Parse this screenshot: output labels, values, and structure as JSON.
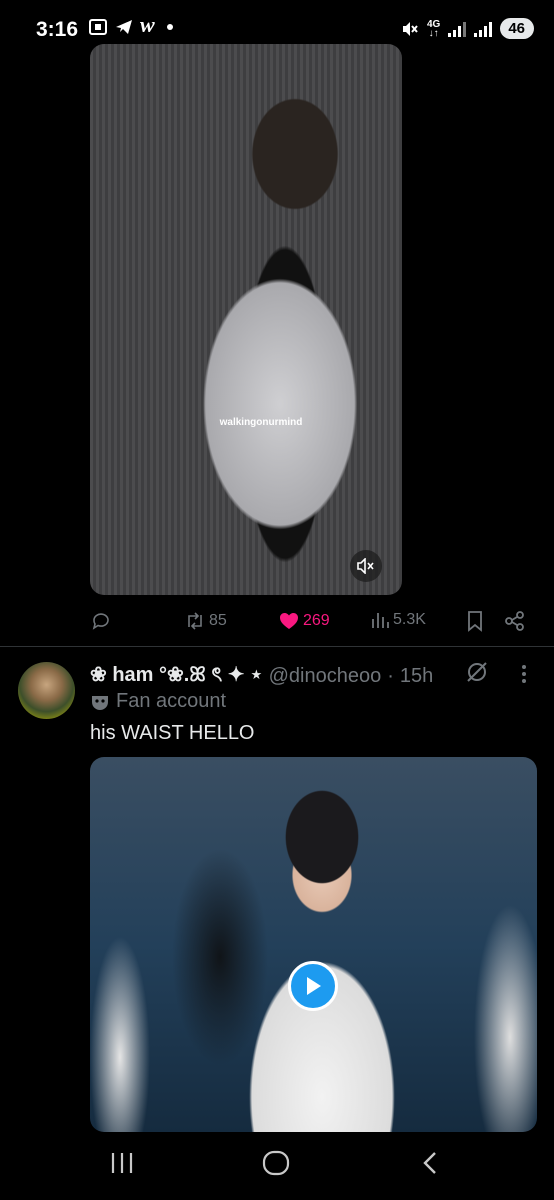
{
  "status_bar": {
    "time": "3:16",
    "app_letter": "w",
    "network": "4G",
    "battery": "46"
  },
  "post1": {
    "watermark": "walkingonurmind",
    "reply_count": "",
    "repost_count": "85",
    "like_count": "269",
    "view_count": "5.3K"
  },
  "post2": {
    "display_name": "❀ ham °❀.ꕤ ৎ ✦ ⋆",
    "handle": "@dinocheoo",
    "separator": "·",
    "time_ago": "15h",
    "label": "Fan account",
    "text": "his WAIST HELLO"
  },
  "colors": {
    "like": "#f91880",
    "muted": "#71767b",
    "accent": "#1d9bf0"
  }
}
